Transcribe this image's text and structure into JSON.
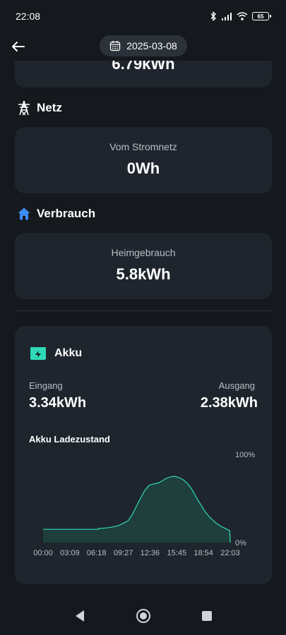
{
  "status_bar": {
    "time": "22:08",
    "battery": "65"
  },
  "header": {
    "date": "2025-03-08"
  },
  "partial_card": {
    "value": "6.79kWh"
  },
  "netz": {
    "title": "Netz",
    "label": "Vom Stromnetz",
    "value": "0Wh"
  },
  "verbrauch": {
    "title": "Verbrauch",
    "label": "Heimgebrauch",
    "value": "5.8kWh"
  },
  "akku": {
    "title": "Akku",
    "eingang_label": "Eingang",
    "eingang_value": "3.34kWh",
    "ausgang_label": "Ausgang",
    "ausgang_value": "2.38kWh",
    "chart_title": "Akku Ladezustand"
  },
  "colors": {
    "background": "#15181d",
    "card": "#1f252d",
    "accent_teal": "#2fd9b8",
    "verbrauch_icon": "#3b8cf5",
    "akku_icon": "#2fd9b8"
  },
  "icons": {
    "back": "arrow-left-icon",
    "calendar": "calendar-icon",
    "netz": "power-tower-icon",
    "verbrauch": "home-icon",
    "akku": "battery-icon"
  },
  "chart_data": {
    "type": "area",
    "title": "Akku Ladezustand",
    "x_ticks": [
      "00:00",
      "03:09",
      "06:18",
      "09:27",
      "12:36",
      "15:45",
      "18:54",
      "22:03"
    ],
    "y_ticks": [
      "0%",
      "100%"
    ],
    "ylim": [
      0,
      100
    ],
    "x_range_hours": [
      0,
      22.05
    ],
    "series": [
      {
        "x_hours": [
          0,
          6.5,
          6.5,
          7.5,
          8.5,
          9.0,
          9.5,
          10.0,
          10.5,
          11.0,
          11.5,
          12.0,
          12.5,
          13.0,
          13.5,
          14.0,
          14.5,
          15.0,
          15.5,
          16.0,
          16.5,
          17.0,
          17.5,
          18.0,
          18.5,
          19.0,
          19.5,
          20.0,
          20.5,
          21.0,
          21.5,
          22.0,
          22.05
        ],
        "y_percent": [
          19,
          19,
          20,
          21,
          23,
          25,
          28,
          31,
          40,
          52,
          64,
          75,
          82,
          84,
          85,
          88,
          92,
          94,
          95,
          93,
          90,
          85,
          77,
          66,
          56,
          46,
          38,
          32,
          27,
          23,
          20,
          17,
          0
        ]
      }
    ],
    "grid": false
  }
}
